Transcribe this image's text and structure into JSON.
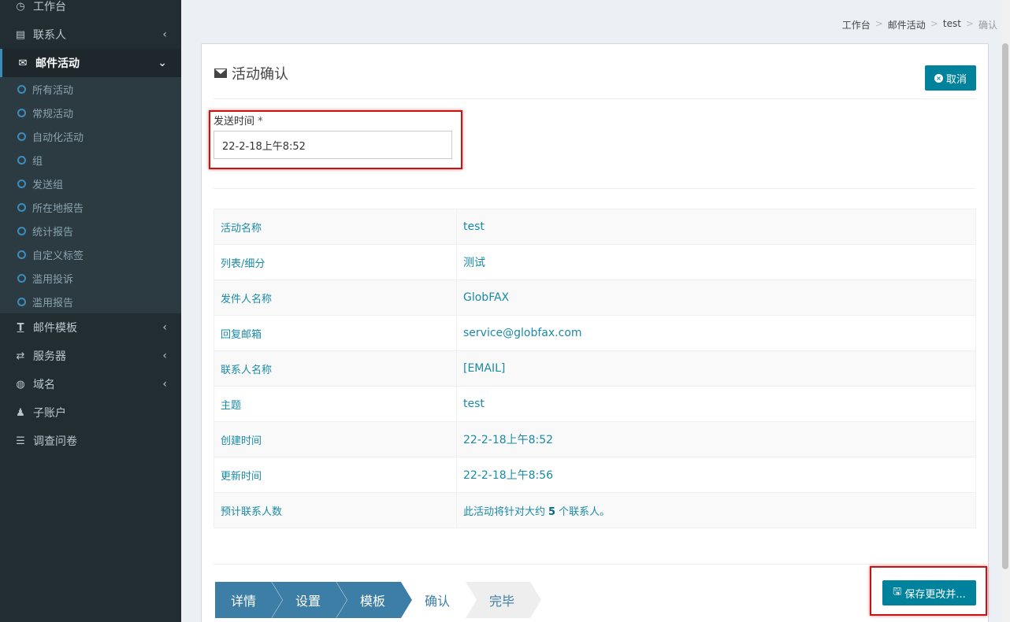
{
  "sidebar": {
    "items": [
      {
        "label": "工作台",
        "icon": "dashboard-icon"
      },
      {
        "label": "联系人",
        "icon": "contacts-icon"
      },
      {
        "label": "邮件活动",
        "icon": "envelope-icon"
      },
      {
        "label": "邮件模板",
        "icon": "text-icon"
      },
      {
        "label": "服务器",
        "icon": "exchange-icon"
      },
      {
        "label": "域名",
        "icon": "globe-icon"
      },
      {
        "label": "子账户",
        "icon": "users-icon"
      },
      {
        "label": "调查问卷",
        "icon": "list-icon"
      }
    ],
    "submenu": [
      "所有活动",
      "常规活动",
      "自动化活动",
      "组",
      "发送组",
      "所在地报告",
      "统计报告",
      "自定义标签",
      "滥用投诉",
      "滥用报告"
    ]
  },
  "breadcrumb": [
    "工作台",
    "邮件活动",
    "test",
    "确认"
  ],
  "breadcrumb_sep": ">",
  "box": {
    "title": "活动确认",
    "cancel_label": "取消"
  },
  "send_time": {
    "label": "发送时间",
    "required_mark": "*",
    "value": "22-2-18上午8:52"
  },
  "info_rows": [
    {
      "key": "活动名称",
      "value": "test"
    },
    {
      "key": "列表/细分",
      "value": "测试"
    },
    {
      "key": "发件人名称",
      "value": "GlobFAX"
    },
    {
      "key": "回复邮箱",
      "value": "service@globfax.com"
    },
    {
      "key": "联系人名称",
      "value": "[EMAIL]"
    },
    {
      "key": "主题",
      "value": "test"
    },
    {
      "key": "创建时间",
      "value": "22-2-18上午8:52"
    },
    {
      "key": "更新时间",
      "value": "22-2-18上午8:56"
    }
  ],
  "estimate": {
    "key": "预计联系人数",
    "prefix": "此活动将针对大约",
    "count": "5",
    "suffix": "个联系人。"
  },
  "steps": [
    "详情",
    "设置",
    "模板",
    "确认",
    "完毕"
  ],
  "save_label": "保存更改并...",
  "colors": {
    "accent": "#00829c",
    "sidebar_bg": "#222d32",
    "step_active": "#3c7ea5",
    "highlight": "#cc1111"
  }
}
